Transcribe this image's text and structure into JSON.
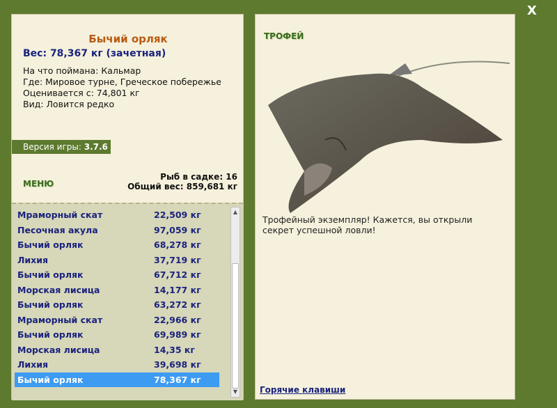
{
  "close_label": "X",
  "catch": {
    "title": "Бычий орляк",
    "weight": "Вес: 78,367 кг (зачетная)",
    "bait": "На что поймана: Кальмар",
    "where": "Где: Мировое турне, Греческое побережье",
    "value": "Оценивается с: 74,801 кг",
    "kind": "Вид: Ловится редко"
  },
  "version": {
    "label": "Версия игры:",
    "value": "3.7.6"
  },
  "menu_label": "МЕНЮ",
  "stats": {
    "fish_count": "Рыб в садке: 16",
    "total_weight": "Общий вес: 859,681 кг"
  },
  "fish_list": [
    {
      "name": "Мраморный скат",
      "weight": "22,509 кг"
    },
    {
      "name": "Песочная акула",
      "weight": "97,059 кг"
    },
    {
      "name": "Бычий орляк",
      "weight": "68,278 кг"
    },
    {
      "name": "Лихия",
      "weight": "37,719 кг"
    },
    {
      "name": "Бычий орляк",
      "weight": "67,712 кг"
    },
    {
      "name": "Морская лисица",
      "weight": "14,177 кг"
    },
    {
      "name": "Бычий орляк",
      "weight": "63,272 кг"
    },
    {
      "name": "Мраморный скат",
      "weight": "22,966 кг"
    },
    {
      "name": "Бычий орляк",
      "weight": "69,989 кг"
    },
    {
      "name": "Морская лисица",
      "weight": "14,35 кг"
    },
    {
      "name": "Лихия",
      "weight": "39,698 кг"
    },
    {
      "name": "Бычий орляк",
      "weight": "78,367 кг",
      "selected": true
    }
  ],
  "trophy_label": "ТРОФЕЙ",
  "description": "Трофейный экземпляр! Кажется, вы открыли секрет успешной ловли!",
  "hotkeys_label": "Горячие клавиши"
}
